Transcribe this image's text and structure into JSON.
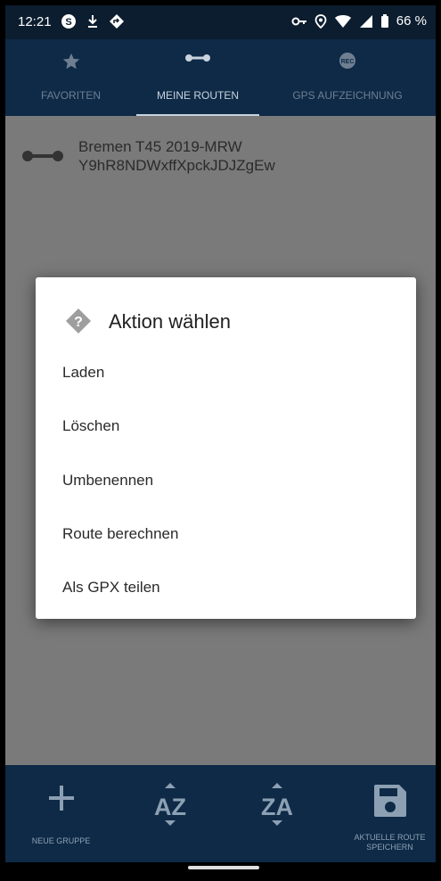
{
  "status_bar": {
    "time": "12:21",
    "battery_percent": "66 %"
  },
  "tabs": [
    {
      "label": "FAVORITEN",
      "icon": "star-icon",
      "active": false
    },
    {
      "label": "MEINE ROUTEN",
      "icon": "route-icon",
      "active": true
    },
    {
      "label": "GPS AUFZEICHNUNG",
      "icon": "rec-icon",
      "active": false
    }
  ],
  "routes": [
    {
      "line1": "Bremen T45 2019-MRW",
      "line2": "Y9hR8NDWxffXpckJDJZgEw"
    }
  ],
  "dialog": {
    "title": "Aktion wählen",
    "items": [
      "Laden",
      "Löschen",
      "Umbenennen",
      "Route berechnen",
      "Als GPX teilen"
    ]
  },
  "bottom_bar": {
    "new_group": "NEUE GRUPPE",
    "sort_az": "AZ",
    "sort_za": "ZA",
    "save_line1": "AKTUELLE ROUTE",
    "save_line2": "SPEICHERN"
  },
  "colors": {
    "appbar": "#0e2a47",
    "statusbar": "#0c1d2f",
    "scrim_background": "#7a7a7a",
    "dialog_bg": "#ffffff"
  }
}
